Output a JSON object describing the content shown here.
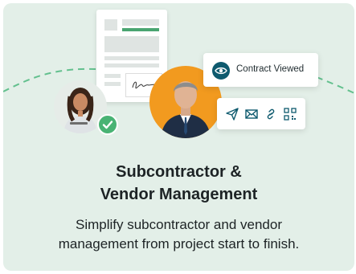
{
  "card": {
    "contract_status_label": "Contract Viewed",
    "title_line1": "Subcontractor &",
    "title_line2": "Vendor Management",
    "description_line1": "Simplify subcontractor and vendor",
    "description_line2": "management from project start to finish.",
    "action_icons": [
      "send-icon",
      "mail-icon",
      "link-icon",
      "qr-code-icon"
    ],
    "status_icon": "eye-icon",
    "check_icon": "check-icon"
  },
  "colors": {
    "card_background": "#e3efe8",
    "accent_green": "#4aa571",
    "eye_badge": "#0e5a6e",
    "avatar_ring": "#f29a1f",
    "text": "#1d2325"
  }
}
